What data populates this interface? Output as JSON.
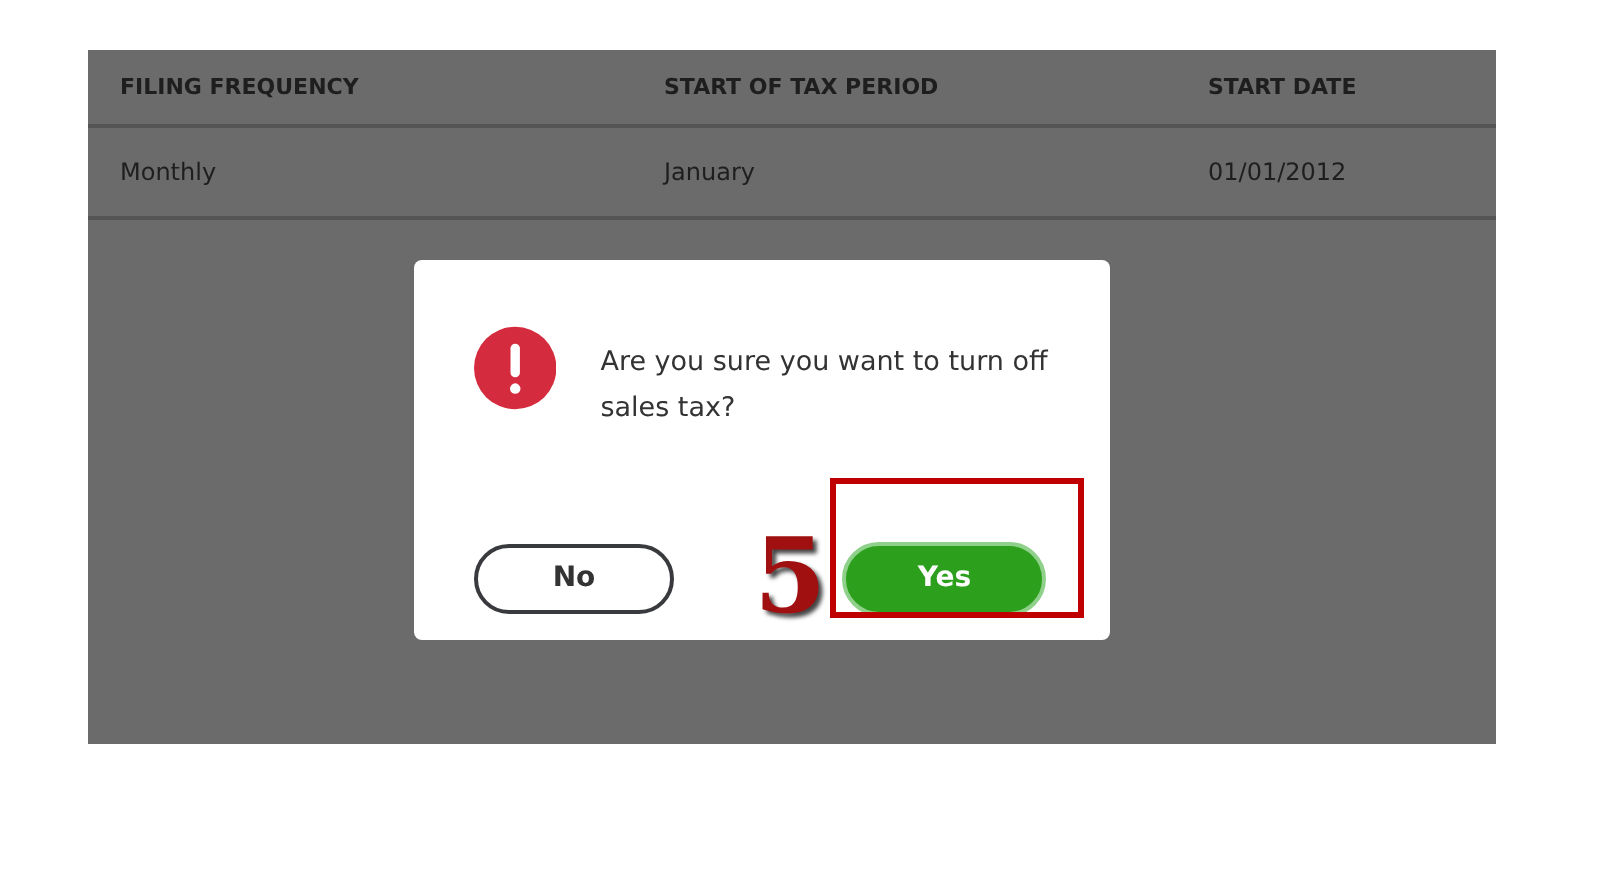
{
  "table": {
    "columns": [
      "FILING FREQUENCY",
      "START OF TAX PERIOD",
      "START DATE"
    ],
    "rows": [
      [
        "Monthly",
        "January",
        "01/01/2012"
      ]
    ]
  },
  "dialog": {
    "message": "Are you sure you want to turn off sales tax?",
    "buttons": [
      {
        "label": "No",
        "kind": "secondary"
      },
      {
        "label": "Yes",
        "kind": "primary"
      }
    ]
  },
  "annotation": {
    "step": "5"
  }
}
